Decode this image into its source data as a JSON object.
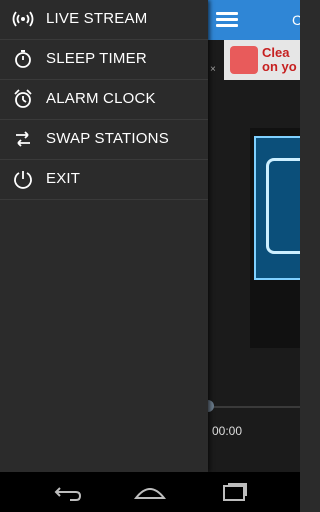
{
  "drawer": {
    "items": [
      {
        "label": "LIVE STREAM",
        "icon": "live-stream-icon"
      },
      {
        "label": "SLEEP TIMER",
        "icon": "sleep-timer-icon"
      },
      {
        "label": "ALARM CLOCK",
        "icon": "alarm-clock-icon"
      },
      {
        "label": "SWAP STATIONS",
        "icon": "swap-icon"
      },
      {
        "label": "EXIT",
        "icon": "power-icon"
      }
    ]
  },
  "app": {
    "header_title": "C",
    "ad_text": "Clea\non yo",
    "ad_close": "×",
    "time": "00:00"
  },
  "colors": {
    "header": "#2f86d6",
    "drawer": "#2b2b2b",
    "text": "#ffffff"
  }
}
